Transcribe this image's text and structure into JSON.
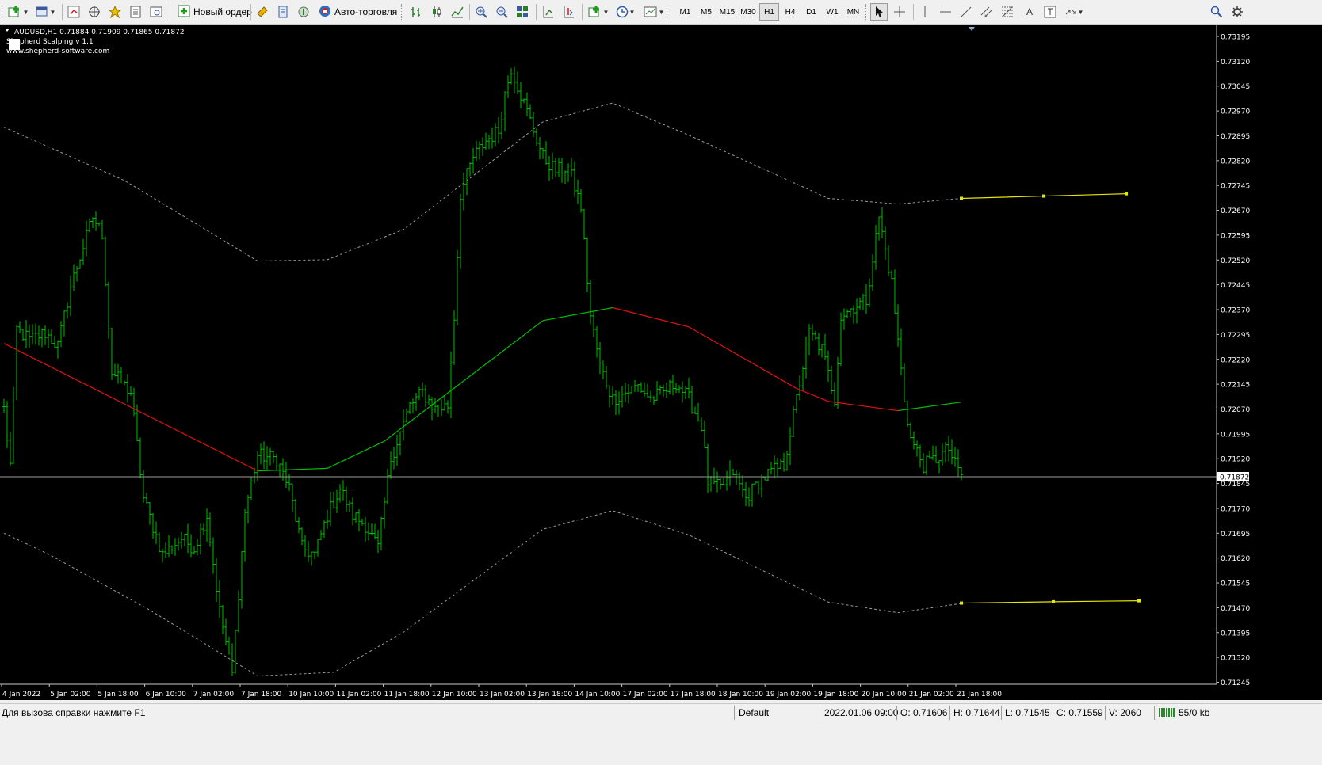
{
  "toolbar": {
    "new_order_label": "Новый ордер",
    "autotrade_label": "Авто-торговля",
    "timeframes": [
      {
        "label": "M1",
        "active": false
      },
      {
        "label": "M5",
        "active": false
      },
      {
        "label": "M15",
        "active": false
      },
      {
        "label": "M30",
        "active": false
      },
      {
        "label": "H1",
        "active": true
      },
      {
        "label": "H4",
        "active": false
      },
      {
        "label": "D1",
        "active": false
      },
      {
        "label": "W1",
        "active": false
      },
      {
        "label": "MN",
        "active": false
      }
    ],
    "icons": [
      "new-chart-icon",
      "profiles-icon",
      "market-watch-icon",
      "navigator-icon",
      "favorites-icon",
      "data-window-icon",
      "terminal-icon",
      "new-order-icon",
      "metaeditor-icon",
      "strategy-tester-icon",
      "signals-icon",
      "autotrading-icon",
      "bar-chart-icon",
      "candlestick-icon",
      "line-chart-icon",
      "zoom-in-icon",
      "zoom-out-icon",
      "tile-windows-icon",
      "auto-scroll-icon",
      "chart-shift-icon",
      "indicators-icon",
      "periods-icon",
      "templates-icon",
      "cursor-icon",
      "crosshair-icon",
      "vertical-line-icon",
      "horizontal-line-icon",
      "trendline-icon",
      "equidistant-channel-icon",
      "fibonacci-icon",
      "text-icon",
      "text-label-icon",
      "arrows-icon",
      "search-icon",
      "settings-icon"
    ]
  },
  "chart": {
    "symbol_line": "AUDUSD,H1  0.71884 0.71909 0.71865 0.71872",
    "indicator_label": "Shepherd Scalping v 1.1",
    "site_label": "www.shepherd-software.com",
    "current_price_label": "0.71872",
    "colors": {
      "background": "#000000",
      "bars": "#00c000",
      "ma_up": "#00c000",
      "ma_down": "#e01010",
      "channel": "#9a9a9a",
      "projection": "#e6e600",
      "price_line": "#9a9a9a",
      "axis_text": "#ffffff"
    }
  },
  "chart_data": {
    "type": "ohlc",
    "symbol": "AUDUSD",
    "timeframe": "H1",
    "ohlc_last": {
      "open": 0.71884,
      "high": 0.71909,
      "low": 0.71865,
      "close": 0.71872
    },
    "current_price": 0.71872,
    "ylim": [
      0.71245,
      0.73195
    ],
    "y_ticks": [
      "0.73195",
      "0.73120",
      "0.73045",
      "0.72970",
      "0.72895",
      "0.72820",
      "0.72745",
      "0.72670",
      "0.72595",
      "0.72520",
      "0.72445",
      "0.72370",
      "0.72295",
      "0.72220",
      "0.72145",
      "0.72070",
      "0.71995",
      "0.71920",
      "0.71845",
      "0.71770",
      "0.71695",
      "0.71620",
      "0.71545",
      "0.71470",
      "0.71395",
      "0.71320",
      "0.71245"
    ],
    "x_ticks": [
      "4 Jan 2022",
      "5 Jan 02:00",
      "5 Jan 18:00",
      "6 Jan 10:00",
      "7 Jan 02:00",
      "7 Jan 18:00",
      "10 Jan 10:00",
      "11 Jan 02:00",
      "11 Jan 18:00",
      "12 Jan 10:00",
      "13 Jan 02:00",
      "13 Jan 18:00",
      "14 Jan 10:00",
      "17 Jan 02:00",
      "17 Jan 18:00",
      "18 Jan 10:00",
      "19 Jan 02:00",
      "19 Jan 18:00",
      "20 Jan 10:00",
      "21 Jan 02:00",
      "21 Jan 18:00"
    ],
    "price_anchors": [
      [
        0,
        0.7207
      ],
      [
        2,
        0.719
      ],
      [
        4,
        0.7231
      ],
      [
        8,
        0.7228
      ],
      [
        13,
        0.723
      ],
      [
        17,
        0.7226
      ],
      [
        21,
        0.7244
      ],
      [
        25,
        0.7256
      ],
      [
        28,
        0.7265
      ],
      [
        31,
        0.726
      ],
      [
        34,
        0.7218
      ],
      [
        40,
        0.7212
      ],
      [
        44,
        0.718
      ],
      [
        50,
        0.7163
      ],
      [
        56,
        0.7168
      ],
      [
        60,
        0.7165
      ],
      [
        64,
        0.7175
      ],
      [
        68,
        0.7146
      ],
      [
        72,
        0.7127
      ],
      [
        76,
        0.7176
      ],
      [
        80,
        0.7193
      ],
      [
        86,
        0.7192
      ],
      [
        90,
        0.7183
      ],
      [
        94,
        0.7165
      ],
      [
        98,
        0.7163
      ],
      [
        102,
        0.7175
      ],
      [
        106,
        0.7183
      ],
      [
        110,
        0.7175
      ],
      [
        114,
        0.7172
      ],
      [
        118,
        0.7165
      ],
      [
        122,
        0.7192
      ],
      [
        128,
        0.7208
      ],
      [
        132,
        0.7212
      ],
      [
        136,
        0.7207
      ],
      [
        140,
        0.7208
      ],
      [
        142,
        0.7235
      ],
      [
        144,
        0.7272
      ],
      [
        148,
        0.7283
      ],
      [
        152,
        0.7288
      ],
      [
        156,
        0.7291
      ],
      [
        158,
        0.7302
      ],
      [
        160,
        0.731
      ],
      [
        163,
        0.7302
      ],
      [
        166,
        0.7294
      ],
      [
        170,
        0.7283
      ],
      [
        174,
        0.7279
      ],
      [
        178,
        0.728
      ],
      [
        182,
        0.7268
      ],
      [
        185,
        0.7235
      ],
      [
        188,
        0.722
      ],
      [
        192,
        0.721
      ],
      [
        196,
        0.7212
      ],
      [
        200,
        0.7214
      ],
      [
        204,
        0.721
      ],
      [
        208,
        0.7212
      ],
      [
        212,
        0.7215
      ],
      [
        216,
        0.721
      ],
      [
        220,
        0.7202
      ],
      [
        222,
        0.7185
      ],
      [
        226,
        0.7183
      ],
      [
        230,
        0.7188
      ],
      [
        234,
        0.718
      ],
      [
        238,
        0.7185
      ],
      [
        242,
        0.7188
      ],
      [
        246,
        0.719
      ],
      [
        250,
        0.721
      ],
      [
        254,
        0.723
      ],
      [
        258,
        0.7225
      ],
      [
        262,
        0.721
      ],
      [
        264,
        0.7235
      ],
      [
        268,
        0.7238
      ],
      [
        272,
        0.724
      ],
      [
        276,
        0.7265
      ],
      [
        280,
        0.7245
      ],
      [
        284,
        0.721
      ],
      [
        286,
        0.7198
      ],
      [
        290,
        0.719
      ],
      [
        294,
        0.7192
      ],
      [
        298,
        0.7195
      ],
      [
        300,
        0.719
      ],
      [
        302,
        0.7187
      ]
    ],
    "ma_line": [
      [
        0,
        0.72268,
        "down"
      ],
      [
        80,
        0.71883,
        "down"
      ],
      [
        102,
        0.71891,
        "up"
      ],
      [
        120,
        0.71973,
        "up"
      ],
      [
        170,
        0.72337,
        "up"
      ],
      [
        192,
        0.72376,
        "up"
      ],
      [
        216,
        0.72318,
        "down"
      ],
      [
        250,
        0.72132,
        "down"
      ],
      [
        260,
        0.72093,
        "down"
      ],
      [
        282,
        0.72065,
        "down"
      ],
      [
        302,
        0.72091,
        "up"
      ]
    ],
    "upper_band": [
      [
        0,
        0.72921
      ],
      [
        38,
        0.7276
      ],
      [
        80,
        0.72517
      ],
      [
        102,
        0.72521
      ],
      [
        126,
        0.72612
      ],
      [
        170,
        0.72937
      ],
      [
        192,
        0.72994
      ],
      [
        216,
        0.72897
      ],
      [
        260,
        0.72706
      ],
      [
        282,
        0.72689
      ],
      [
        302,
        0.72706
      ]
    ],
    "lower_band": [
      [
        0,
        0.71695
      ],
      [
        14,
        0.71632
      ],
      [
        46,
        0.71463
      ],
      [
        80,
        0.71264
      ],
      [
        104,
        0.71275
      ],
      [
        126,
        0.71396
      ],
      [
        170,
        0.71707
      ],
      [
        192,
        0.71763
      ],
      [
        216,
        0.7169
      ],
      [
        260,
        0.71487
      ],
      [
        282,
        0.71455
      ],
      [
        302,
        0.71483
      ]
    ],
    "upper_projection": [
      [
        302,
        0.72706
      ],
      [
        328,
        0.72713
      ],
      [
        354,
        0.7272
      ]
    ],
    "lower_projection": [
      [
        302,
        0.71484
      ],
      [
        331,
        0.71488
      ],
      [
        358,
        0.71491
      ]
    ]
  },
  "status": {
    "help_text": "Для вызова справки нажмите F1",
    "profile": "Default",
    "datetime": "2022.01.06 09:00",
    "open": "O: 0.71606",
    "high": "H: 0.71644",
    "low": "L: 0.71545",
    "close": "C: 0.71559",
    "volume": "V: 2060",
    "traffic": "55/0 kb"
  }
}
